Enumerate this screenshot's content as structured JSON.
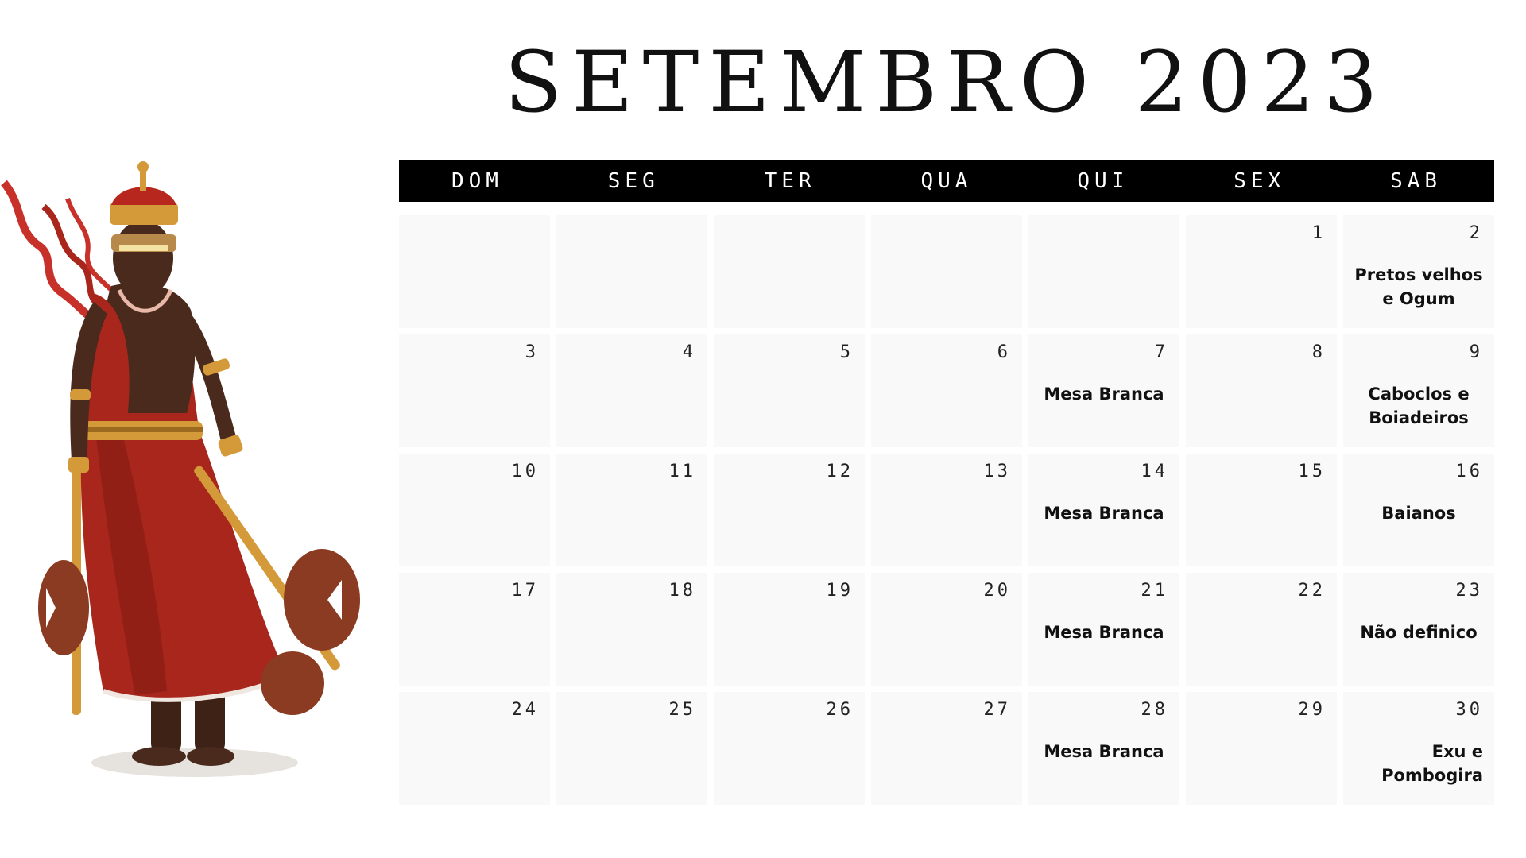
{
  "calendar": {
    "title": "SETEMBRO 2023",
    "weekdays": [
      "DOM",
      "SEG",
      "TER",
      "QUA",
      "QUI",
      "SEX",
      "SAB"
    ],
    "weeks": [
      [
        {
          "day": "",
          "event": ""
        },
        {
          "day": "",
          "event": ""
        },
        {
          "day": "",
          "event": ""
        },
        {
          "day": "",
          "event": ""
        },
        {
          "day": "",
          "event": ""
        },
        {
          "day": "1",
          "event": ""
        },
        {
          "day": "2",
          "event": "Pretos velhos e Ogum"
        }
      ],
      [
        {
          "day": "3",
          "event": ""
        },
        {
          "day": "4",
          "event": ""
        },
        {
          "day": "5",
          "event": ""
        },
        {
          "day": "6",
          "event": ""
        },
        {
          "day": "7",
          "event": "Mesa Branca"
        },
        {
          "day": "8",
          "event": ""
        },
        {
          "day": "9",
          "event": "Caboclos e Boiadeiros"
        }
      ],
      [
        {
          "day": "10",
          "event": ""
        },
        {
          "day": "11",
          "event": ""
        },
        {
          "day": "12",
          "event": ""
        },
        {
          "day": "13",
          "event": ""
        },
        {
          "day": "14",
          "event": "Mesa Branca"
        },
        {
          "day": "15",
          "event": ""
        },
        {
          "day": "16",
          "event": "Baianos"
        }
      ],
      [
        {
          "day": "17",
          "event": ""
        },
        {
          "day": "18",
          "event": ""
        },
        {
          "day": "19",
          "event": ""
        },
        {
          "day": "20",
          "event": ""
        },
        {
          "day": "21",
          "event": "Mesa Branca"
        },
        {
          "day": "22",
          "event": ""
        },
        {
          "day": "23",
          "event": "Não definico"
        }
      ],
      [
        {
          "day": "24",
          "event": ""
        },
        {
          "day": "25",
          "event": ""
        },
        {
          "day": "26",
          "event": ""
        },
        {
          "day": "27",
          "event": ""
        },
        {
          "day": "28",
          "event": "Mesa Branca"
        },
        {
          "day": "29",
          "event": ""
        },
        {
          "day": "30",
          "event": "Exu e Pombogira"
        }
      ]
    ]
  },
  "illustration": {
    "icon": "warrior-orixa-illustration",
    "colors": {
      "skin": "#4a2a1c",
      "robe": "#a8261c",
      "robe_dark": "#7d1a12",
      "gold": "#d49a3a",
      "gold_dark": "#9c6a1e",
      "axe_blade": "#8a3b22",
      "ribbon": "#c8302a"
    }
  }
}
